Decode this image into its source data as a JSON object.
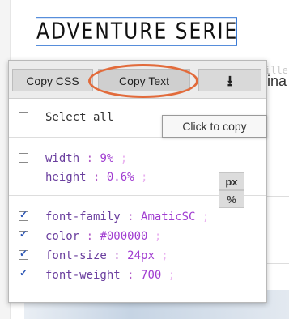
{
  "page": {
    "title": "ADVENTURE SERIES",
    "ghost_text": "ille",
    "body_fragment": "ina"
  },
  "toolbar": {
    "copy_css_label": "Copy CSS",
    "copy_text_label": "Copy Text",
    "download_glyph": "⭳"
  },
  "panel": {
    "select_all_label": "Select all",
    "tooltip": "Click to copy",
    "size_props": [
      {
        "prop": "width",
        "value": "9%",
        "checked": false
      },
      {
        "prop": "height",
        "value": "0.6%",
        "checked": false
      }
    ],
    "units": {
      "px": "px",
      "pct": "%"
    },
    "font_props": [
      {
        "prop": "font-family",
        "value": "AmaticSC",
        "checked": true
      },
      {
        "prop": "color",
        "value": "#000000",
        "checked": true
      },
      {
        "prop": "font-size",
        "value": "24px",
        "checked": true
      },
      {
        "prop": "font-weight",
        "value": "700",
        "checked": true
      }
    ]
  },
  "colors": {
    "highlight_ring": "#e26b3b",
    "title_border": "#3a7bd5"
  }
}
